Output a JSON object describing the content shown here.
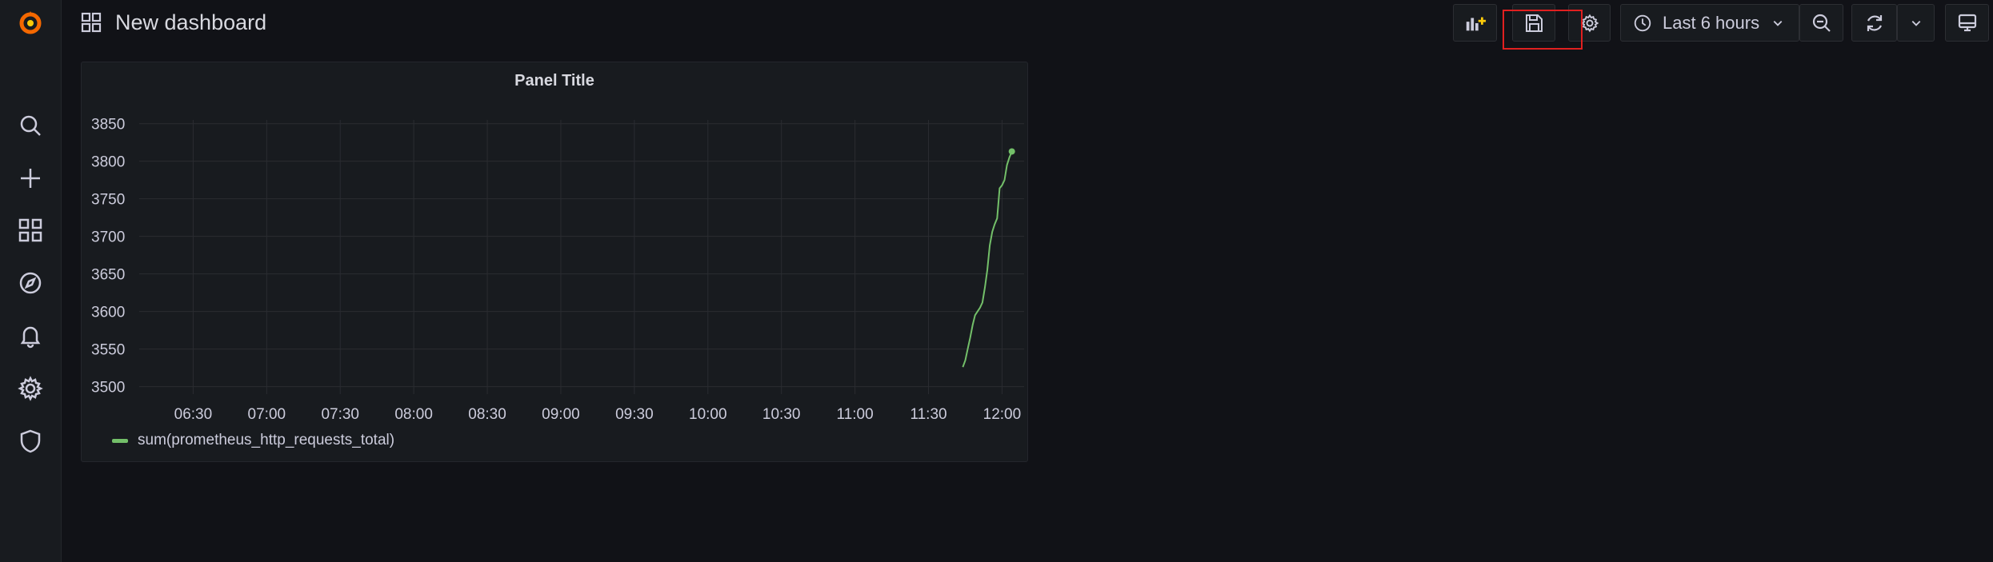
{
  "dashboard": {
    "title": "New dashboard"
  },
  "toolbar": {
    "time_range": "Last 6 hours"
  },
  "sidebar": {
    "items": [
      {
        "icon": "grafana-logo"
      },
      {
        "icon": "search-icon"
      },
      {
        "icon": "plus-icon"
      },
      {
        "icon": "dashboards-icon"
      },
      {
        "icon": "explore-icon"
      },
      {
        "icon": "bell-icon"
      },
      {
        "icon": "gear-icon"
      },
      {
        "icon": "shield-icon"
      }
    ]
  },
  "colors": {
    "series": "#73bf69",
    "highlight": "#e02020",
    "accent": "#f46800"
  },
  "panel": {
    "title": "Panel Title",
    "legend": "sum(prometheus_http_requests_total)"
  },
  "chart_data": {
    "type": "line",
    "title": "Panel Title",
    "xlabel": "",
    "ylabel": "",
    "x_ticks": [
      "06:30",
      "07:00",
      "07:30",
      "08:00",
      "08:30",
      "09:00",
      "09:30",
      "10:00",
      "10:30",
      "11:00",
      "11:30",
      "12:00"
    ],
    "y_ticks": [
      3500,
      3550,
      3600,
      3650,
      3700,
      3750,
      3800,
      3850
    ],
    "ylim": [
      3490,
      3855
    ],
    "xlim": [
      "06:08",
      "12:09"
    ],
    "grid": true,
    "legend_position": "bottom-left",
    "series": [
      {
        "name": "sum(prometheus_http_requests_total)",
        "x": [
          "11:44",
          "11:45",
          "11:46",
          "11:47",
          "11:48",
          "11:49",
          "11:50",
          "11:51",
          "11:52",
          "11:53",
          "11:54",
          "11:55",
          "11:56",
          "11:57",
          "11:58",
          "11:59",
          "12:00",
          "12:01",
          "12:02",
          "12:03",
          "12:04"
        ],
        "values": [
          3526,
          3535,
          3550,
          3565,
          3582,
          3595,
          3600,
          3605,
          3612,
          3632,
          3655,
          3688,
          3706,
          3716,
          3724,
          3764,
          3768,
          3775,
          3795,
          3805,
          3813
        ]
      }
    ]
  }
}
